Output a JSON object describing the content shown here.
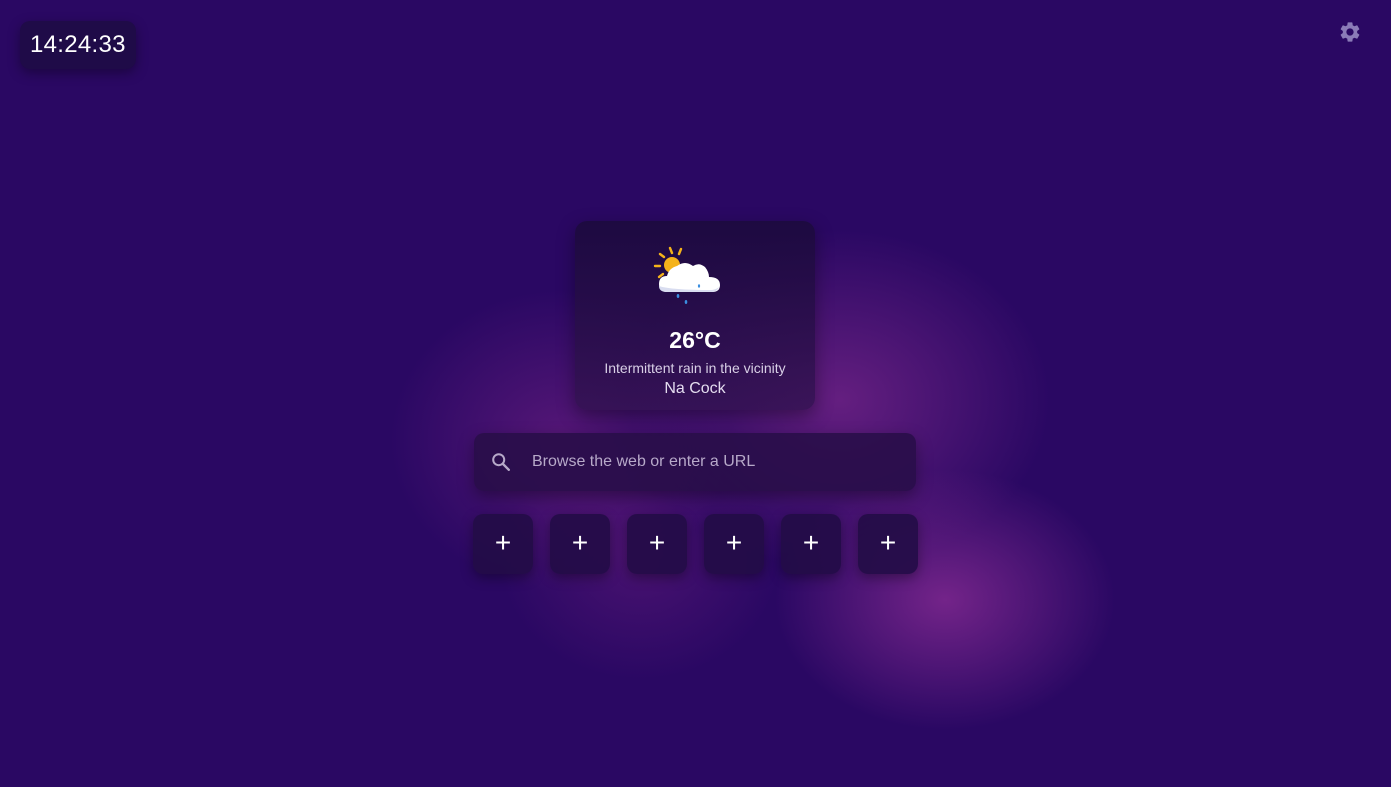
{
  "clock": {
    "time": "14:24:33"
  },
  "settings": {
    "icon": "gear-icon"
  },
  "weather": {
    "icon": "sun-behind-rain-cloud-icon",
    "temperature": "26°C",
    "condition": "Intermittent rain in the vicinity",
    "location": "Na Cock"
  },
  "search": {
    "icon": "search-icon",
    "placeholder": "Browse the web or enter a URL",
    "value": ""
  },
  "shortcuts": [
    {
      "label": "+"
    },
    {
      "label": "+"
    },
    {
      "label": "+"
    },
    {
      "label": "+"
    },
    {
      "label": "+"
    },
    {
      "label": "+"
    }
  ],
  "colors": {
    "background": "#2a0863",
    "glow": "#8c2d96",
    "card": "#1f0b48",
    "text": "#ffffff"
  }
}
